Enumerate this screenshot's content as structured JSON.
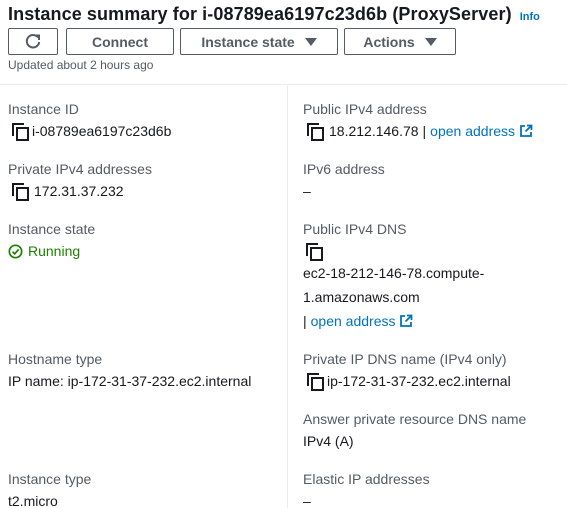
{
  "header": {
    "title": "Instance summary for i-08789ea6197c23d6b (ProxyServer)",
    "info_label": "Info"
  },
  "toolbar": {
    "refresh_icon": "refresh-icon",
    "connect_label": "Connect",
    "instance_state_label": "Instance state",
    "actions_label": "Actions"
  },
  "updated_text": "Updated about 2 hours ago",
  "left": {
    "instance_id": {
      "label": "Instance ID",
      "value": "i-08789ea6197c23d6b"
    },
    "private_ipv4": {
      "label": "Private IPv4 addresses",
      "value": "172.31.37.232"
    },
    "instance_state": {
      "label": "Instance state",
      "value": "Running",
      "color": "#1d8102"
    },
    "hostname_type": {
      "label": "Hostname type",
      "value": "IP name: ip-172-31-37-232.ec2.internal"
    },
    "instance_type": {
      "label": "Instance type",
      "value": "t2.micro"
    }
  },
  "right": {
    "public_ipv4": {
      "label": "Public IPv4 address",
      "value": "18.212.146.78",
      "link": "open address"
    },
    "ipv6": {
      "label": "IPv6 address",
      "value": "–"
    },
    "public_dns": {
      "label": "Public IPv4 DNS",
      "value_line1": "ec2-18-212-146-78.compute-",
      "value_line2": "1.amazonaws.com",
      "link": "open address"
    },
    "private_dns": {
      "label": "Private IP DNS name (IPv4 only)",
      "value": "ip-172-31-37-232.ec2.internal"
    },
    "answer_dns": {
      "label": "Answer private resource DNS name",
      "value": "IPv4 (A)"
    },
    "elastic_ip": {
      "label": "Elastic IP addresses",
      "value": "–"
    }
  },
  "colors": {
    "link": "#0073bb",
    "success": "#1d8102",
    "text": "#16191f",
    "label": "#545b64"
  }
}
